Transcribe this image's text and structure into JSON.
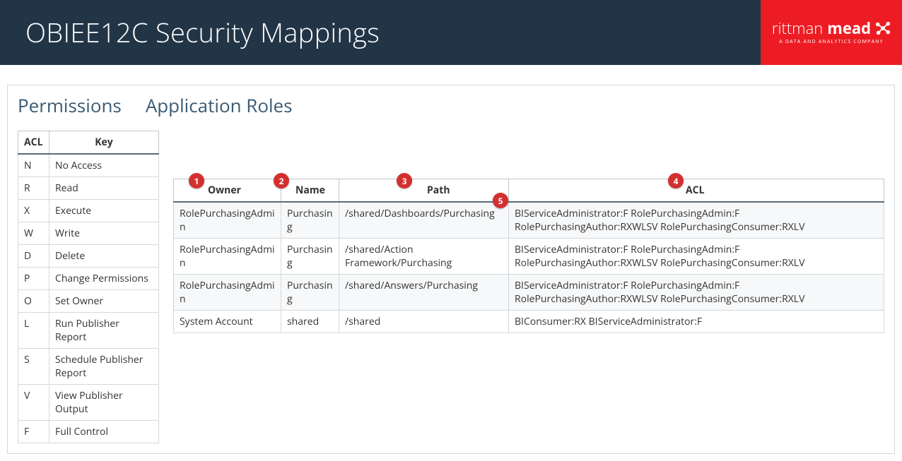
{
  "header": {
    "title": "OBIEE12C Security Mappings",
    "brand_light": "rittman",
    "brand_bold": "mead",
    "brand_tag": "A DATA AND ANALYTICS COMPANY"
  },
  "tabs": {
    "permissions": "Permissions",
    "application_roles": "Application Roles"
  },
  "permissions_key": {
    "headers": {
      "acl": "ACL",
      "key": "Key"
    },
    "rows": [
      {
        "acl": "N",
        "key": "No Access"
      },
      {
        "acl": "R",
        "key": "Read"
      },
      {
        "acl": "X",
        "key": "Execute"
      },
      {
        "acl": "W",
        "key": "Write"
      },
      {
        "acl": "D",
        "key": "Delete"
      },
      {
        "acl": "P",
        "key": "Change Permissions"
      },
      {
        "acl": "O",
        "key": "Set Owner"
      },
      {
        "acl": "L",
        "key": "Run Publisher Report"
      },
      {
        "acl": "S",
        "key": "Schedule Publisher Report"
      },
      {
        "acl": "V",
        "key": "View Publisher Output"
      },
      {
        "acl": "F",
        "key": "Full Control"
      }
    ]
  },
  "data_table": {
    "headers": {
      "owner": "Owner",
      "name": "Name",
      "path": "Path",
      "acl": "ACL"
    },
    "rows": [
      {
        "owner": "RolePurchasingAdmin",
        "name": "Purchasing",
        "path": "/shared/Dashboards/Purchasing",
        "acl": "BIServiceAdministrator:F RolePurchasingAdmin:F RolePurchasingAuthor:RXWLSV RolePurchasingConsumer:RXLV"
      },
      {
        "owner": "RolePurchasingAdmin",
        "name": "Purchasing",
        "path": "/shared/Action Framework/Purchasing",
        "acl": "BIServiceAdministrator:F RolePurchasingAdmin:F RolePurchasingAuthor:RXWLSV RolePurchasingConsumer:RXLV"
      },
      {
        "owner": "RolePurchasingAdmin",
        "name": "Purchasing",
        "path": "/shared/Answers/Purchasing",
        "acl": "BIServiceAdministrator:F RolePurchasingAdmin:F RolePurchasingAuthor:RXWLSV RolePurchasingConsumer:RXLV"
      },
      {
        "owner": "System Account",
        "name": "shared",
        "path": "/shared",
        "acl": "BIConsumer:RX BIServiceAdministrator:F"
      }
    ]
  },
  "markers": {
    "m1": "1",
    "m2": "2",
    "m3": "3",
    "m4": "4",
    "m5": "5"
  }
}
